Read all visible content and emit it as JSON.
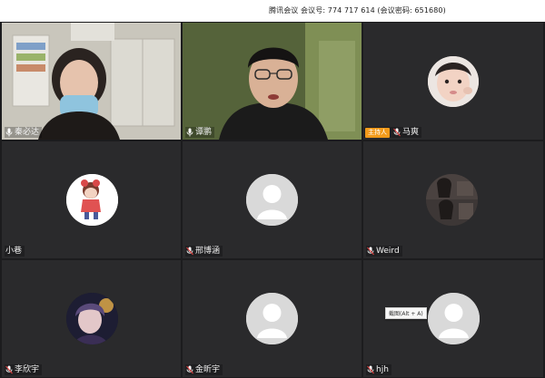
{
  "meeting": {
    "title": "腾讯会议  会议号: 774 717 614  (会议密码: 651680)"
  },
  "participants": [
    {
      "name": "秦必达",
      "video": true,
      "host": false
    },
    {
      "name": "谭鹏",
      "video": true,
      "host": false
    },
    {
      "name": "马爽",
      "video": false,
      "host": true,
      "host_label": "主持人"
    },
    {
      "name": "小巷",
      "video": false,
      "host": false
    },
    {
      "name": "邢博涵",
      "video": false,
      "host": false
    },
    {
      "name": "Weird",
      "video": false,
      "host": false
    },
    {
      "name": "李欣宇",
      "video": false,
      "host": false
    },
    {
      "name": "金昕宇",
      "video": false,
      "host": false
    },
    {
      "name": "hjh",
      "video": false,
      "host": false
    }
  ],
  "tooltip": {
    "text": "截图(Alt + A)"
  },
  "colors": {
    "host_badge": "#f29a1a",
    "tile_bg": "#2a2a2c",
    "grid_bg": "#1c1c1e"
  }
}
